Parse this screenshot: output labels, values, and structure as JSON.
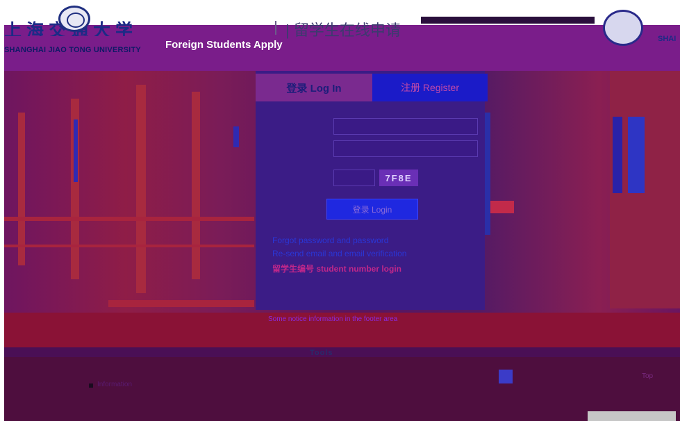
{
  "header": {
    "logo_cn": "上海交通大学",
    "logo_en": "SHANGHAI JIAO TONG UNIVERSITY",
    "subtitle_cn": "| 留学生在线申请",
    "subtitle_en": "Foreign Students Apply",
    "logo_right_en": "SHAI"
  },
  "login": {
    "tab_login": "登录 Log In",
    "tab_register": "注册 Register",
    "email_label": "",
    "email_placeholder": "",
    "password_label": "",
    "password_placeholder": "",
    "captcha_label": "",
    "captcha_text": "7F8E",
    "login_button": "登录 Login",
    "links": {
      "forgot": "Forgot password and password",
      "resend": "Re-send email and email verification",
      "number": "留学生编号 student number login"
    }
  },
  "footer": {
    "notice": "Some notice information in the footer area",
    "tools": "Tools",
    "link": "Information",
    "right": "Top"
  },
  "colors": {
    "header": "#7a1d8a",
    "panel": "#3b1c86",
    "register_tab": "#1b1bc8",
    "login_button": "#1f28e0"
  }
}
